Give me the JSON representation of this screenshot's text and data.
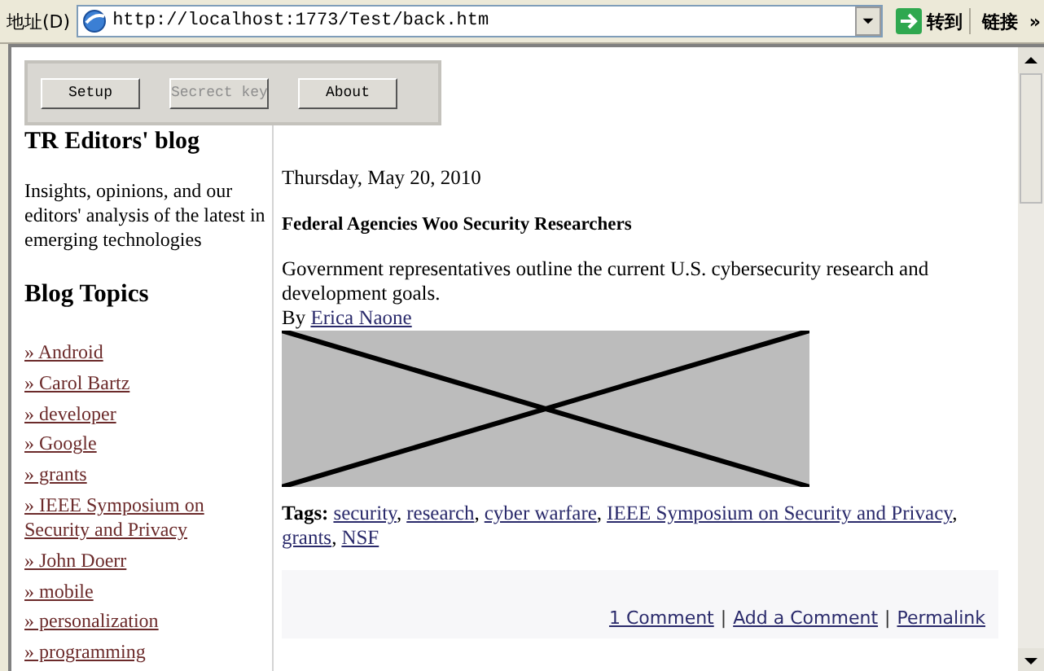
{
  "address_bar": {
    "label": "地址(D)",
    "url": "http://localhost:1773/Test/back.htm",
    "go_label": "转到",
    "links_label": "链接",
    "more": "»"
  },
  "toolbar_buttons": [
    {
      "label": "Setup",
      "disabled": false
    },
    {
      "label": "Secrect key",
      "disabled": true
    },
    {
      "label": "About",
      "disabled": false
    }
  ],
  "sidebar": {
    "title": "TR Editors' blog",
    "description": "Insights, opinions, and our editors' analysis of the latest in emerging technologies",
    "topics_heading": "Blog Topics",
    "topics": [
      "» Android",
      "» Carol Bartz",
      "» developer",
      "» Google",
      "» grants",
      "» IEEE Symposium on Security and Privacy",
      "» John Doerr",
      "» mobile",
      "» personalization",
      "» programming"
    ]
  },
  "post": {
    "date": "Thursday, May 20, 2010",
    "title": "Federal Agencies Woo Security Researchers",
    "summary": "Government representatives outline the current U.S. cybersecurity research and development goals.",
    "byline_prefix": "By",
    "author": "Erica Naone",
    "image": {
      "kind": "broken-image"
    },
    "tags_label": "Tags:",
    "tags": [
      {
        "label": "security",
        "separator": ","
      },
      {
        "label": "research",
        "separator": ","
      },
      {
        "label": "cyber warfare",
        "separator": ","
      },
      {
        "label": "IEEE Symposium on Security and Privacy",
        "separator": ","
      },
      {
        "label": "grants",
        "separator": ","
      },
      {
        "label": "NSF"
      }
    ],
    "footer": [
      {
        "kind": "link",
        "text": "1 Comment"
      },
      {
        "kind": "separator",
        "text": "|"
      },
      {
        "kind": "link",
        "text": "Add a Comment"
      },
      {
        "kind": "separator",
        "text": "|"
      },
      {
        "kind": "link",
        "text": "Permalink"
      }
    ]
  }
}
